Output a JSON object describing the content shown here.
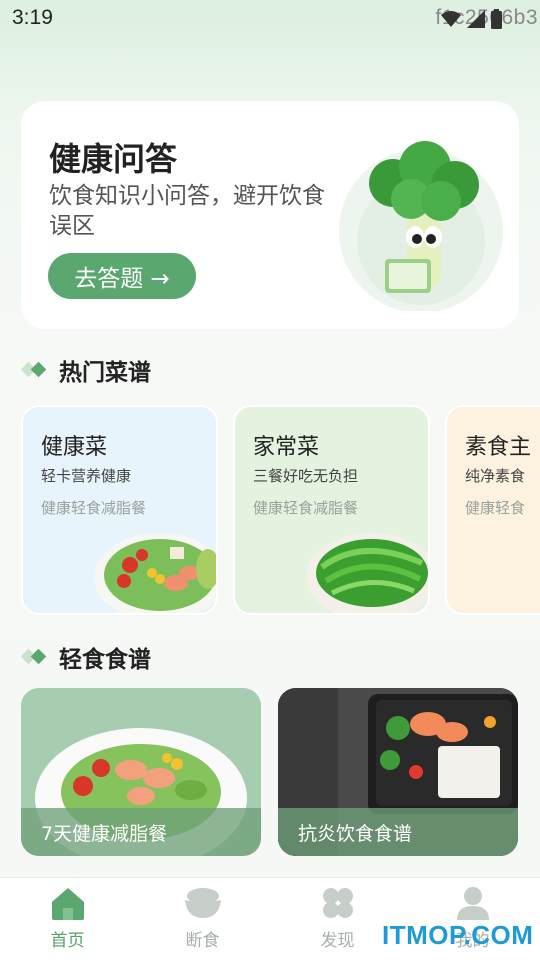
{
  "status_bar": {
    "time": "3:19",
    "debug_text": "f1c2566b3"
  },
  "hero": {
    "title": "健康问答",
    "subtitle": "饮食知识小问答，避开饮食误区",
    "button_label": "去答题 →"
  },
  "sections": {
    "hot_recipes": {
      "title": "热门菜谱"
    },
    "light_meals": {
      "title": "轻食食谱"
    }
  },
  "hot_recipes": [
    {
      "title": "健康菜",
      "desc": "轻卡营养健康",
      "tag": "健康轻食减脂餐",
      "bg": "#e8f4fc"
    },
    {
      "title": "家常菜",
      "desc": "三餐好吃无负担",
      "tag": "健康轻食减脂餐",
      "bg": "#e3f3e0"
    },
    {
      "title": "素食主",
      "desc": "纯净素食",
      "tag": "健康轻食",
      "bg": "#fdf1df"
    }
  ],
  "light_meals": [
    {
      "caption": "7天健康减脂餐"
    },
    {
      "caption": "抗炎饮食食谱"
    }
  ],
  "tabs": [
    {
      "label": "首页",
      "icon": "home-icon",
      "active": true
    },
    {
      "label": "断食",
      "icon": "bowl-icon",
      "active": false
    },
    {
      "label": "发现",
      "icon": "discover-icon",
      "active": false
    },
    {
      "label": "我的",
      "icon": "profile-icon",
      "active": false
    }
  ],
  "watermark": "ITMOP.COM",
  "colors": {
    "accent": "#5aa86f",
    "active_tab": "#55a26a",
    "inactive_tab": "#c7cec9"
  }
}
